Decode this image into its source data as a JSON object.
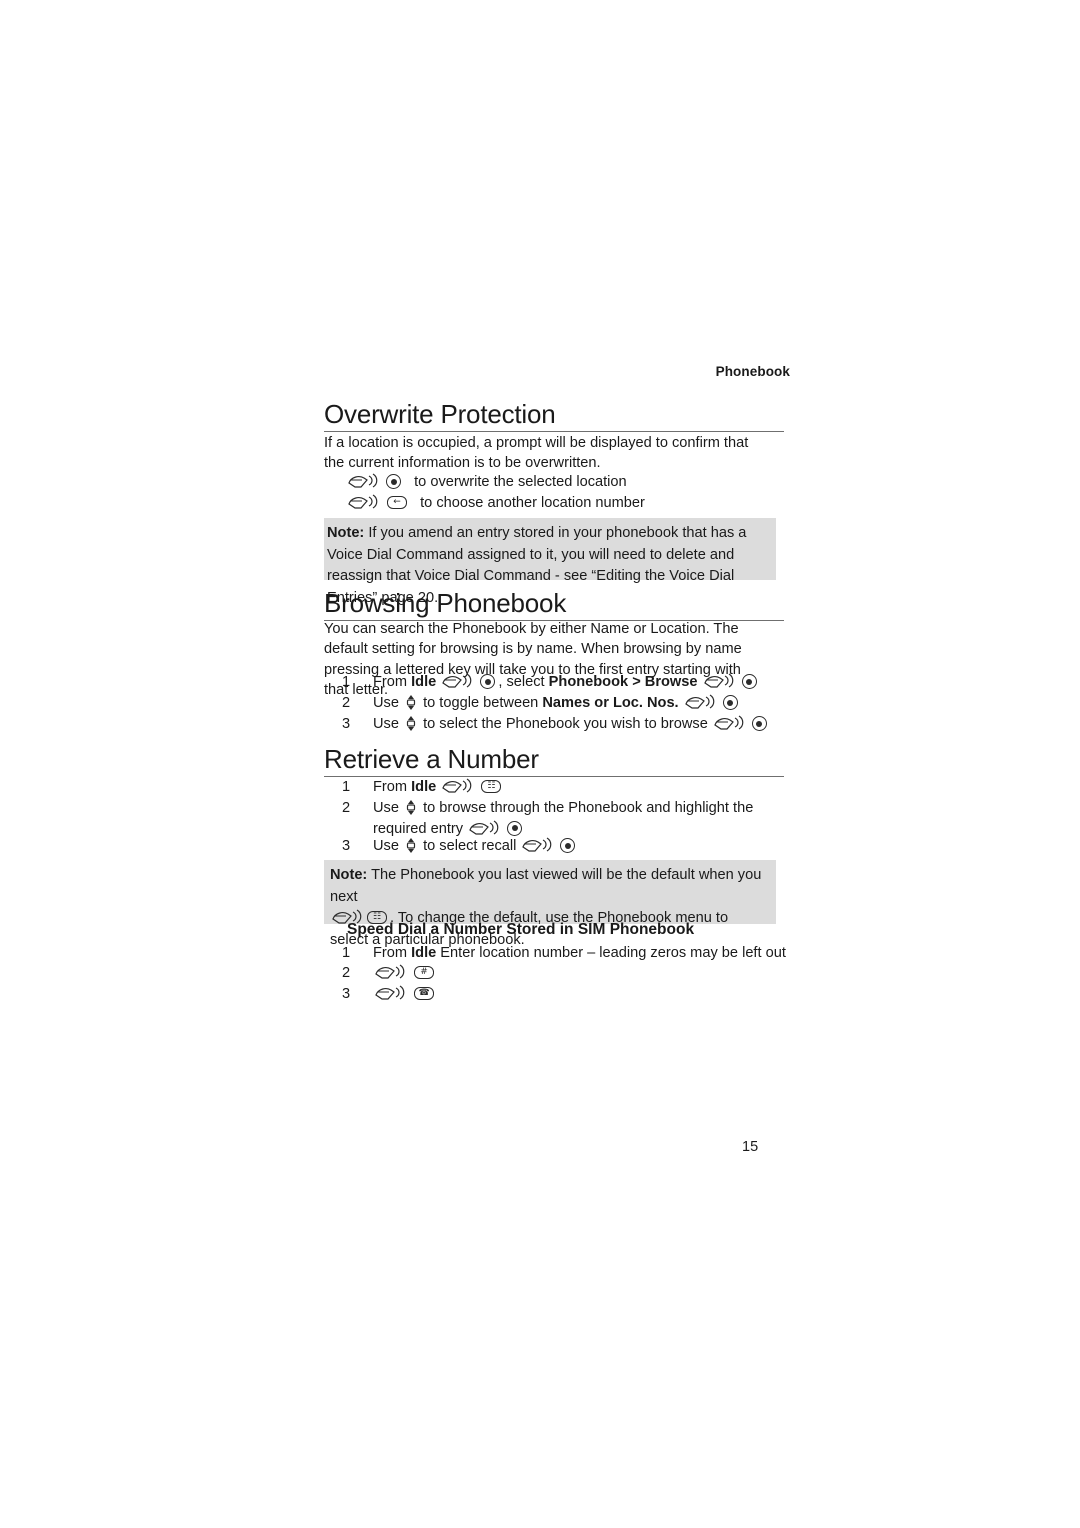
{
  "header": {
    "running_head": "Phonebook"
  },
  "page_number": "15",
  "sections": {
    "overwrite": {
      "title": "Overwrite Protection",
      "intro": "If a location is occupied, a prompt will be displayed to confirm that the current information is to be overwritten.",
      "options": [
        {
          "icons": [
            "press-icon",
            "select-key-icon"
          ],
          "label": "to overwrite the selected location"
        },
        {
          "icons": [
            "press-icon",
            "back-key-icon"
          ],
          "label": "to choose another location number"
        }
      ],
      "note_label": "Note:",
      "note_text": " If you amend an entry stored in your phonebook that has a Voice Dial Command assigned to it, you will need to delete and reassign that Voice Dial Command - see “Editing the Voice Dial Entries” page 20."
    },
    "browsing": {
      "title": "Browsing Phonebook",
      "intro": "You can search the Phonebook by either Name or Location. The default setting for browsing is by name. When browsing by name pressing a lettered key will take you to the first entry starting with that letter.",
      "steps": [
        {
          "num": "1",
          "pre": "From ",
          "bold1": "Idle",
          "mid": ", select ",
          "bold2": "Phonebook",
          "sep": " > ",
          "bold3": "Browse",
          "post": ""
        },
        {
          "num": "2",
          "pre": "Use ",
          "mid": "to toggle between ",
          "bold1": "Names",
          "sep": " or ",
          "bold2": "Loc. Nos.",
          "post": ""
        },
        {
          "num": "3",
          "pre": "Use ",
          "mid": "to select the Phonebook you wish to browse",
          "post": ""
        }
      ]
    },
    "retrieve": {
      "title": "Retrieve a Number",
      "steps": [
        {
          "num": "1",
          "pre": "From ",
          "bold1": "Idle",
          "post": ""
        },
        {
          "num": "2",
          "pre": "Use ",
          "mid": "to browse through the Phonebook and highlight the required entry",
          "post": ""
        },
        {
          "num": "3",
          "pre": "Use ",
          "mid": "to select recall",
          "post": ""
        }
      ],
      "note_label": "Note:",
      "note_text_1": " The Phonebook you last viewed will be the default when you next",
      "note_text_2": ". To change the default, use the Phonebook menu to select a particular phonebook.",
      "subheading": "Speed Dial a Number Stored in SIM Phonebook",
      "sub_steps": [
        {
          "num": "1",
          "pre": "From ",
          "bold1": "Idle",
          "post": " Enter location number – leading zeros may be left out"
        },
        {
          "num": "2",
          "icons": [
            "press-icon",
            "hash-key-icon"
          ]
        },
        {
          "num": "3",
          "icons": [
            "press-icon",
            "send-key-icon"
          ]
        }
      ]
    }
  },
  "icons": {
    "press": "press-icon",
    "select": "select-key-icon",
    "back": "back-key-icon",
    "nav": "up-down-nav-icon",
    "hash": "hash-key-icon",
    "send": "send-key-icon"
  }
}
